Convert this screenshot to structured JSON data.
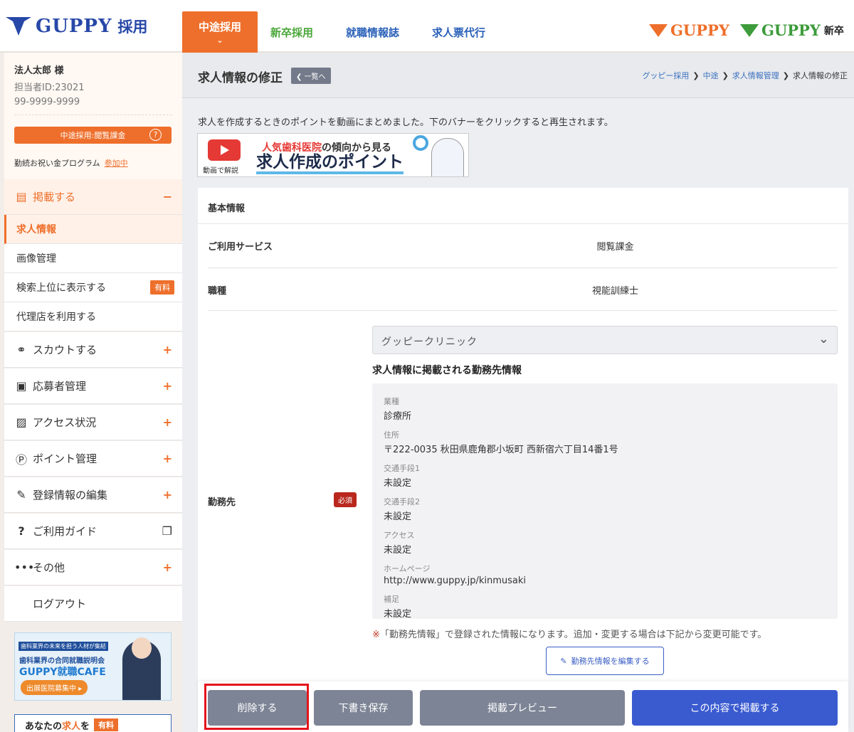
{
  "header": {
    "logo_text": "GUPPY",
    "logo_sub": "採用",
    "tabs": [
      {
        "label": "中途採用"
      },
      {
        "label": "新卒採用"
      },
      {
        "label": "就職情報誌"
      },
      {
        "label": "求人票代行"
      }
    ],
    "right_logos": [
      {
        "text": "GUPPY",
        "suffix": ""
      },
      {
        "text": "GUPPY",
        "suffix": "新卒"
      }
    ],
    "colors": {
      "accent": "#ee6f2b",
      "brand_blue": "#2748a8",
      "green": "#4aa63a"
    }
  },
  "profile": {
    "name": "法人太郎 様",
    "staff_id": "担当者ID:23021",
    "phone": "99-9999-9999",
    "plan_button": "中途採用:閲覧課金",
    "help_icon": "?",
    "program_label": "勤続お祝い金プログラム",
    "program_status": "参加中"
  },
  "sidebar": {
    "post": {
      "label": "掲載する",
      "toggle": "−"
    },
    "sub_items": [
      {
        "label": "求人情報"
      },
      {
        "label": "画像管理"
      },
      {
        "label": "検索上位に表示する",
        "badge": "有料"
      },
      {
        "label": "代理店を利用する"
      }
    ],
    "menus": [
      {
        "label": "スカウトする",
        "icon": "binoculars-icon",
        "toggle": "+"
      },
      {
        "label": "応募者管理",
        "icon": "id-card-icon",
        "toggle": "+"
      },
      {
        "label": "アクセス状況",
        "icon": "image-chart-icon",
        "toggle": "+"
      },
      {
        "label": "ポイント管理",
        "icon": "point-icon",
        "toggle": "+"
      },
      {
        "label": "登録情報の編集",
        "icon": "pencil-icon",
        "toggle": "+"
      },
      {
        "label": "ご利用ガイド",
        "icon": "question-icon",
        "toggle": "❐"
      },
      {
        "label": "その他",
        "icon": "dots-icon",
        "toggle": "+"
      },
      {
        "label": "ログアウト"
      }
    ],
    "banner_cafe": {
      "tag": "歯科業界の未来を担う人材が集結",
      "line1": "歯科業界の合同就職説明会",
      "line2": "GUPPY就職CAFE",
      "cta": "出展医院募集中 ▸"
    },
    "banner_paid": {
      "prefix": "あなたの",
      "highlight": "求人",
      "suffix": "を",
      "tag": "有料"
    }
  },
  "page": {
    "title": "求人情報の修正",
    "back_label": "一覧へ",
    "breadcrumb": [
      "グッピー採用",
      "中途",
      "求人情報管理",
      "求人情報の修正"
    ],
    "intro": "求人を作成するときのポイントを動画にまとめました。下のバナーをクリックすると再生されます。",
    "video_banner": {
      "caption": "動画で解説",
      "line1_red": "人気歯科医院",
      "line1_rest": "の傾向から見る",
      "line2": "求人作成のポイント"
    }
  },
  "form": {
    "section": "基本情報",
    "service_label": "ご利用サービス",
    "service_value": "閲覧課金",
    "job_label": "職種",
    "job_value": "視能訓練士",
    "workplace_label": "勤務先",
    "required_badge": "必須",
    "workplace_select": "グッピークリニック",
    "workplace_heading": "求人情報に掲載される勤務先情報",
    "workplace_fields": [
      {
        "key": "業種",
        "value": "診療所"
      },
      {
        "key": "住所",
        "value": "〒222-0035 秋田県鹿角郡小坂町 西新宿六丁目14番1号"
      },
      {
        "key": "交通手段1",
        "value": "未設定"
      },
      {
        "key": "交通手段2",
        "value": "未設定"
      },
      {
        "key": "アクセス",
        "value": "未設定"
      },
      {
        "key": "ホームページ",
        "value": "http://www.guppy.jp/kinmusaki"
      },
      {
        "key": "補足",
        "value": "未設定"
      }
    ],
    "note_mark": "※",
    "note": "「勤務先情報」で登録された情報になります。追加・変更する場合は下記から変更可能です。",
    "edit_workplace_button": "勤務先情報を編集する"
  },
  "actions": {
    "delete": "削除する",
    "draft": "下書き保存",
    "preview": "掲載プレビュー",
    "publish": "この内容で掲載する",
    "highlight_color": "#e3141c"
  }
}
